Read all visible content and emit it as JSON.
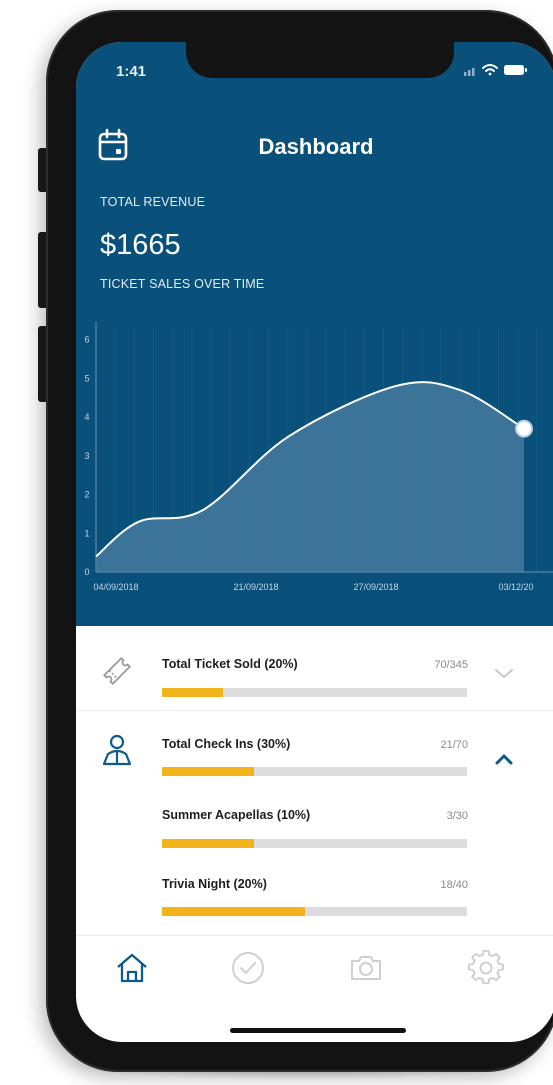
{
  "status_bar": {
    "time": "1:41"
  },
  "header": {
    "title": "Dashboard",
    "icon": "calendar-icon"
  },
  "revenue": {
    "label": "TOTAL REVENUE",
    "value": "$1665"
  },
  "sales_chart_label": "TICKET SALES OVER TIME",
  "chart_data": {
    "type": "area",
    "title": "",
    "x_tick_labels": [
      "04/09/2018",
      "21/09/2018",
      "27/09/2018",
      "03/12/20"
    ],
    "y_ticks": [
      0,
      1,
      2,
      3,
      4,
      5,
      6
    ],
    "ylim": [
      0,
      6.3
    ],
    "x": [
      0,
      0.1,
      0.25,
      0.45,
      0.7,
      0.85,
      1.0
    ],
    "values": [
      0.4,
      1.3,
      1.6,
      3.5,
      4.8,
      4.7,
      3.7
    ],
    "grid": true,
    "colors": {
      "background": "#09507b",
      "line": "#ffffff",
      "fill": "#4e7fa3"
    }
  },
  "stats": [
    {
      "icon": "ticket-icon",
      "title": "Total Ticket Sold (20%)",
      "count": "70/345",
      "progress": 0.2,
      "chevron": "chevron-down-icon"
    },
    {
      "icon": "user-icon",
      "title": "Total Check Ins (30%)",
      "count": "21/70",
      "progress": 0.3,
      "chevron": "chevron-up-icon"
    }
  ],
  "sub_stats": [
    {
      "title": "Summer Acapellas (10%)",
      "count": "3/30",
      "progress": 0.3
    },
    {
      "title": "Trivia Night (20%)",
      "count": "18/40",
      "progress": 0.47
    }
  ],
  "tab_bar": [
    {
      "icon": "home-icon",
      "active": true
    },
    {
      "icon": "check-circle-icon",
      "active": false
    },
    {
      "icon": "camera-icon",
      "active": false
    },
    {
      "icon": "gear-icon",
      "active": false
    }
  ],
  "colors": {
    "brand_blue": "#09507b",
    "accent_yellow": "#f2b31a",
    "track_gray": "#dcdcdc"
  }
}
